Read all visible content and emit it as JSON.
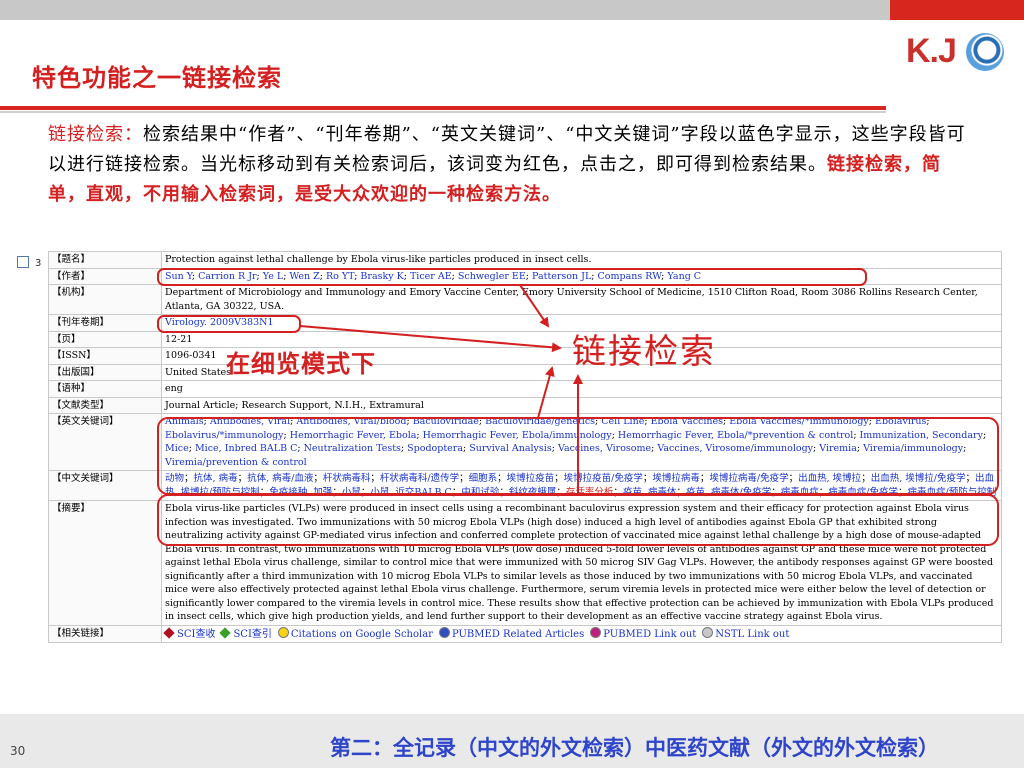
{
  "slide": {
    "title": "特色功能之一链接检索",
    "page_number": "30",
    "logo_text": "K.J",
    "description": {
      "lead": "链接检索：",
      "body": "检索结果中“作者”、“刊年卷期”、“英文关键词”、“中文关键词”字段以蓝色字显示，这些字段皆可以进行链接检索。当光标移动到有关检索词后，该词变为红色，点击之，即可得到检索结果。",
      "emphasis": "链接检索，简单，直观，不用输入检索词，是受大众欢迎的一种检索方法。"
    },
    "annotations": {
      "link_search": "链接检索",
      "detail_mode": "在细览模式下"
    },
    "bottom_text": "第二：全记录（中文的外文检索）中医药文献（外文的外文检索）"
  },
  "record": {
    "index": "3",
    "labels": {
      "title": "【题名】",
      "authors": "【作者】",
      "org": "【机构】",
      "issue": "【刊年卷期】",
      "pages": "【页】",
      "issn": "【ISSN】",
      "country": "【出版国】",
      "language": "【语种】",
      "doctype": "【文献类型】",
      "en_kw": "【英文关键词】",
      "cn_kw": "【中文关键词】",
      "abstract": "【摘要】",
      "related": "【相关链接】"
    },
    "title": "Protection against lethal challenge by Ebola virus-like particles produced in insect cells.",
    "authors": [
      "Sun Y",
      "Carrion R Jr",
      "Ye L",
      "Wen Z",
      "Ro YT",
      "Brasky K",
      "Ticer AE",
      "Schwegler EE",
      "Patterson JL",
      "Compans RW",
      "Yang C"
    ],
    "org": "Department of Microbiology and Immunology and Emory Vaccine Center, Emory University School of Medicine, 1510 Clifton Road, Room 3086 Rollins Research Center, Atlanta, GA 30322, USA.",
    "issue": "Virology. 2009V383N1",
    "pages": "12-21",
    "issn": "1096-0341",
    "country": "United States",
    "language": "eng",
    "doctype": "Journal Article; Research Support, N.I.H., Extramural",
    "en_keywords": [
      "Animals",
      "Antibodies, Viral",
      "Antibodies, Viral/blood",
      "Baculoviridae",
      "Baculoviridae/genetics",
      "Cell Line",
      "Ebola Vaccines",
      "Ebola Vaccines/*immunology",
      "Ebolavirus",
      "Ebolavirus/*immunology",
      "Hemorrhagic Fever, Ebola",
      "Hemorrhagic Fever, Ebola/immunology",
      "Hemorrhagic Fever, Ebola/*prevention & control",
      "Immunization, Secondary",
      "Mice",
      "Mice, Inbred BALB C",
      "Neutralization Tests",
      "Spodoptera",
      "Survival Analysis",
      "Vaccines, Virosome",
      "Vaccines, Virosome/immunology",
      "Viremia",
      "Viremia/immunology",
      "Viremia/prevention & control"
    ],
    "cn_keywords": [
      {
        "text": "动物",
        "hover": false
      },
      {
        "text": "抗体, 病毒",
        "hover": false
      },
      {
        "text": "抗体, 病毒/血液",
        "hover": false
      },
      {
        "text": "杆状病毒科",
        "hover": false
      },
      {
        "text": "杆状病毒科/遗传学",
        "hover": false
      },
      {
        "text": "细胞系",
        "hover": false
      },
      {
        "text": "埃博拉疫苗",
        "hover": false
      },
      {
        "text": "埃博拉疫苗/免疫学",
        "hover": false
      },
      {
        "text": "埃博拉病毒",
        "hover": false
      },
      {
        "text": "埃博拉病毒/免疫学",
        "hover": false
      },
      {
        "text": "出血热, 埃博拉",
        "hover": false
      },
      {
        "text": "出血热, 埃博拉/免疫学",
        "hover": false
      },
      {
        "text": "出血热, 埃博拉/预防与控制",
        "hover": false
      },
      {
        "text": "免疫接种, 加强",
        "hover": false
      },
      {
        "text": "小鼠",
        "hover": false
      },
      {
        "text": "小鼠, 近交BALB C",
        "hover": false
      },
      {
        "text": "中和试验",
        "hover": false
      },
      {
        "text": "斜纹夜蛾属",
        "hover": false
      },
      {
        "text": "存活率分析",
        "hover": true
      },
      {
        "text": "疫苗, 病毒体",
        "hover": false
      },
      {
        "text": "疫苗, 病毒体/免疫学",
        "hover": false
      },
      {
        "text": "病毒血症",
        "hover": false
      },
      {
        "text": "病毒血症/免疫学",
        "hover": false
      },
      {
        "text": "病毒血症/预防与控制",
        "hover": false
      }
    ],
    "abstract": "Ebola virus-like particles (VLPs) were produced in insect cells using a recombinant baculovirus expression system and their efficacy for protection against Ebola virus infection was investigated. Two immunizations with 50 microg Ebola VLPs (high dose) induced a high level of antibodies against Ebola GP that exhibited strong neutralizing activity against GP-mediated virus infection and conferred complete protection of vaccinated mice against lethal challenge by a high dose of mouse-adapted Ebola virus. In contrast, two immunizations with 10 microg Ebola VLPs (low dose) induced 5-fold lower levels of antibodies against GP and these mice were not protected against lethal Ebola virus challenge, similar to control mice that were immunized with 50 microg SIV Gag VLPs. However, the antibody responses against GP were boosted significantly after a third immunization with 10 microg Ebola VLPs to similar levels as those induced by two immunizations with 50 microg Ebola VLPs, and vaccinated mice were also effectively protected against lethal Ebola virus challenge. Furthermore, serum viremia levels in protected mice were either below the level of detection or significantly lower compared to the viremia levels in control mice. These results show that effective protection can be achieved by immunization with Ebola VLPs produced in insect cells, which give high production yields, and lend further support to their development as an effective vaccine strategy against Ebola virus.",
    "related_links": [
      {
        "label": "SCI查收",
        "icon": "red-diamond-icon",
        "color": "#b01020",
        "shape": "diamond"
      },
      {
        "label": "SCI查引",
        "icon": "green-diamond-icon",
        "color": "#3aa02a",
        "shape": "diamond"
      },
      {
        "label": "Citations on Google Scholar",
        "icon": "yellow-circle-icon",
        "color": "#f5d31a",
        "shape": "dot"
      },
      {
        "label": "PUBMED Related Articles",
        "icon": "blue-circle-icon",
        "color": "#3050c0",
        "shape": "dot"
      },
      {
        "label": "PUBMED Link out",
        "icon": "magenta-circle-icon",
        "color": "#c02080",
        "shape": "dot"
      },
      {
        "label": "NSTL Link out",
        "icon": "gray-circle-icon",
        "color": "#c8c8c8",
        "shape": "dot"
      }
    ]
  },
  "colors": {
    "accent_red": "#d42020",
    "link_blue": "#1a33c8",
    "header_gray": "#c8c8c8"
  }
}
